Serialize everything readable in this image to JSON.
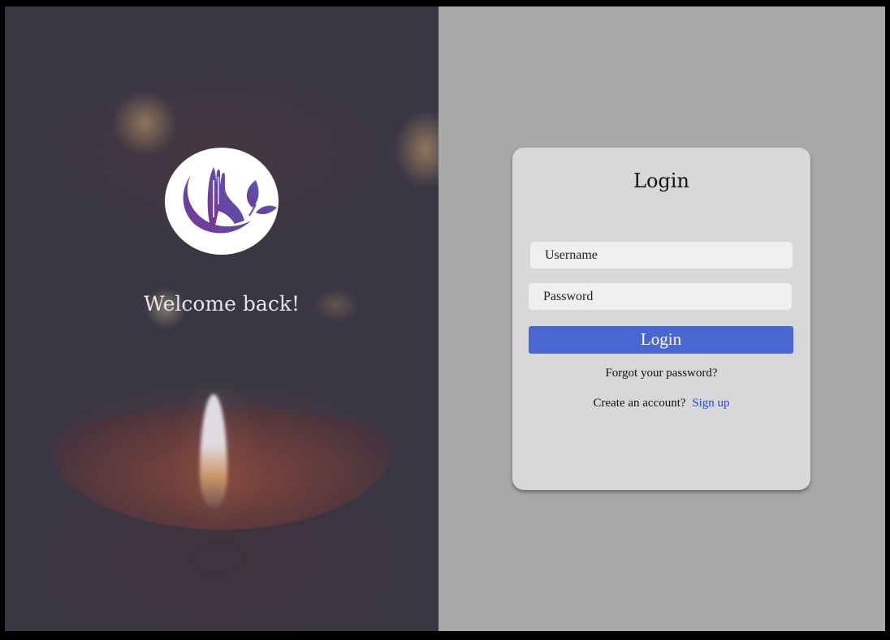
{
  "brand": {
    "welcome_text": "Welcome back!",
    "logo_icon": "praying-hands-leaf-logo",
    "logo_gradient": [
      "#7a3590",
      "#4a5fb8"
    ]
  },
  "login_form": {
    "title": "Login",
    "username_placeholder": "Username",
    "password_placeholder": "Password",
    "login_button_label": "Login",
    "forgot_password_link": "Forgot your password?",
    "create_account_prompt": "Create an account?",
    "sign_up_link": "Sign up"
  },
  "colors": {
    "primary_button": "#4a66d1",
    "link": "#2b45c2",
    "right_background": "#a8a8a8",
    "card_background": "#d8d8d8"
  }
}
